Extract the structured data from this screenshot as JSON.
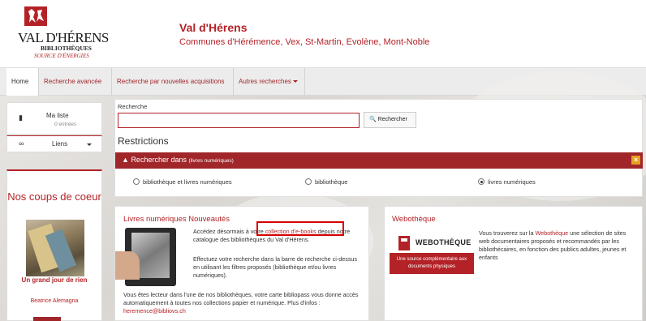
{
  "brand": {
    "logo_title": "VAL D'HÉRENS",
    "logo_subtitle": "BIBLIOTHÈQUES",
    "logo_tagline": "SOURCE D'ÉNERGIES",
    "site_title": "Val d'Hérens",
    "site_subtitle": "Communes d'Hérémence, Vex, St-Martin, Evolène, Mont-Noble"
  },
  "nav": {
    "items": [
      {
        "label": "Home"
      },
      {
        "label": "Recherche avancée"
      },
      {
        "label": "Recherche par nouvelles acquisitions"
      },
      {
        "label": "Autres recherches"
      }
    ]
  },
  "sidebar": {
    "ma_liste": {
      "title": "Ma liste",
      "count": "0 entrées"
    },
    "liens": {
      "label": "Liens"
    },
    "coups": {
      "title": "Nos coups de coeur",
      "book_title": "Un grand jour de rien",
      "book_author": "Beatrice Alemagna"
    }
  },
  "search": {
    "label": "Recherche",
    "button_label": "Rechercher",
    "restrictions_title": "Restrictions",
    "scope_bar_label": "Rechercher dans",
    "scope_bar_sublabel": "(livres numériques)",
    "options": [
      {
        "label": "bibliothèque et livres numériques",
        "selected": false
      },
      {
        "label": "bibliothèque",
        "selected": false
      },
      {
        "label": "livres numériques",
        "selected": true
      }
    ]
  },
  "ebook_card": {
    "title": "Livres numériques Nouveautés",
    "p1_before": "Accédez désormais à votre ",
    "p1_link": "collection d'e-books",
    "p1_after": " depuis notre catalogue des bibliothèques du Val d'Hérens.",
    "p2": "Effectuez votre recherche dans la barre de recherche ci-dessus en utilisant les filtres proposés (bibliothèque et/ou livres numériques).",
    "p3": "Vous êtes lecteur dans l'une de nos bibliothèques, votre carte bibliopass vous donne accès automatiquement à toutes nos collections papier et numérique. Plus d'infos : ",
    "email": "heremence@bibliovs.ch"
  },
  "web_card": {
    "title": "Webothèque",
    "logo_text": "WEBOTHÈQUE",
    "banner": "Une source complémentaire aux documents physiques",
    "text_before": "Vous trouverez sur la ",
    "text_link": "Webothèque",
    "text_after": " une sélection de sites web documentaires proposés et recommandés par les bibliothécaires, en fonction des publics adultes, jeunes et enfants"
  },
  "colors": {
    "accent": "#b32227",
    "bar": "#a0262a",
    "close": "#e8a020"
  }
}
